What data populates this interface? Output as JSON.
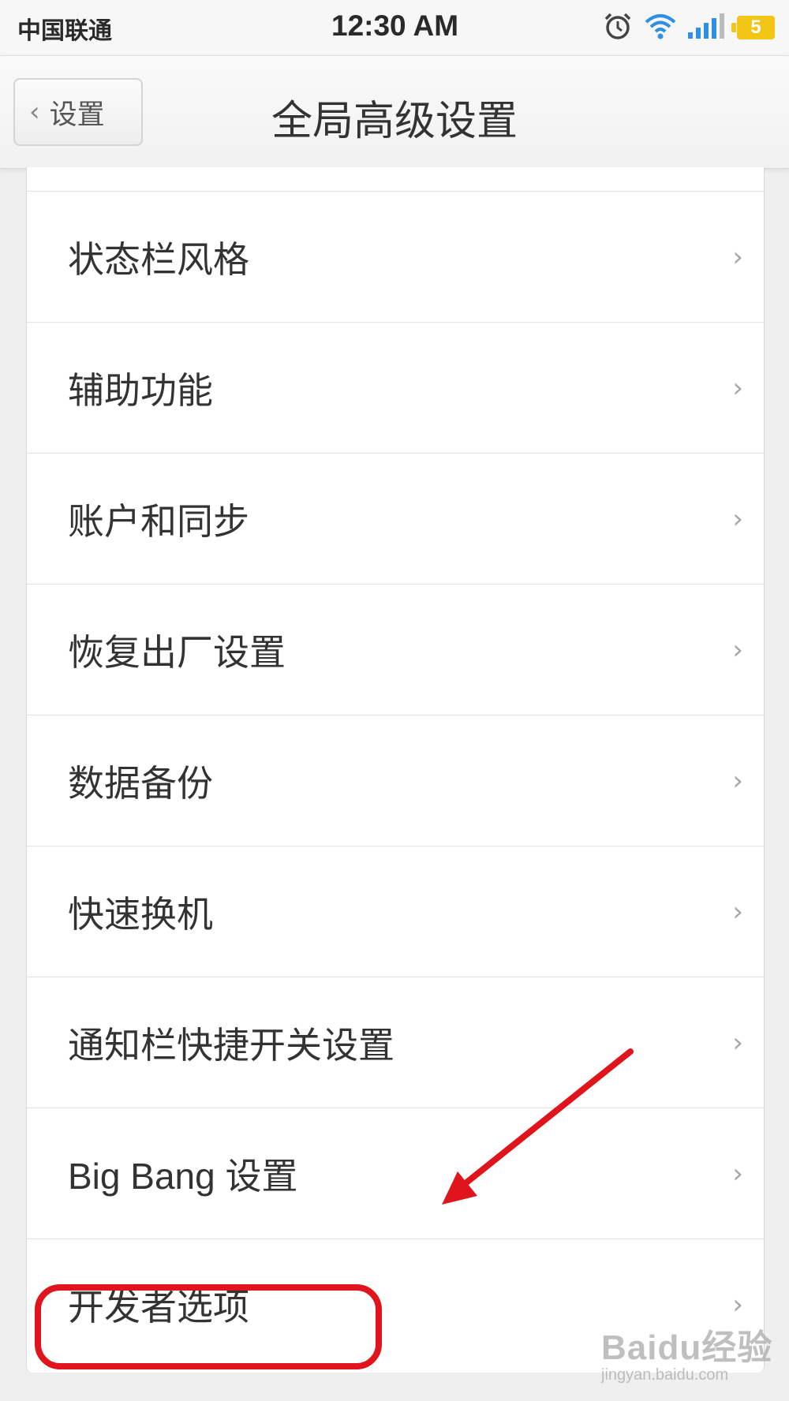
{
  "status_bar": {
    "carrier": "中国联通",
    "time": "12:30 AM",
    "battery": "5",
    "icons": [
      "alarm-icon",
      "wifi-icon",
      "signal-icon",
      "battery-icon"
    ]
  },
  "nav": {
    "back_label": "设置",
    "title": "全局高级设置"
  },
  "settings": {
    "items": [
      {
        "label": "状态栏风格"
      },
      {
        "label": "辅助功能"
      },
      {
        "label": "账户和同步"
      },
      {
        "label": "恢复出厂设置"
      },
      {
        "label": "数据备份"
      },
      {
        "label": "快速换机"
      },
      {
        "label": "通知栏快捷开关设置"
      },
      {
        "label": "Big Bang 设置"
      },
      {
        "label": "开发者选项"
      }
    ]
  },
  "annotation": {
    "highlighted_item": "开发者选项",
    "color": "#e0141c"
  },
  "watermark": {
    "brand": "Baidu经验",
    "url": "jingyan.baidu.com"
  }
}
